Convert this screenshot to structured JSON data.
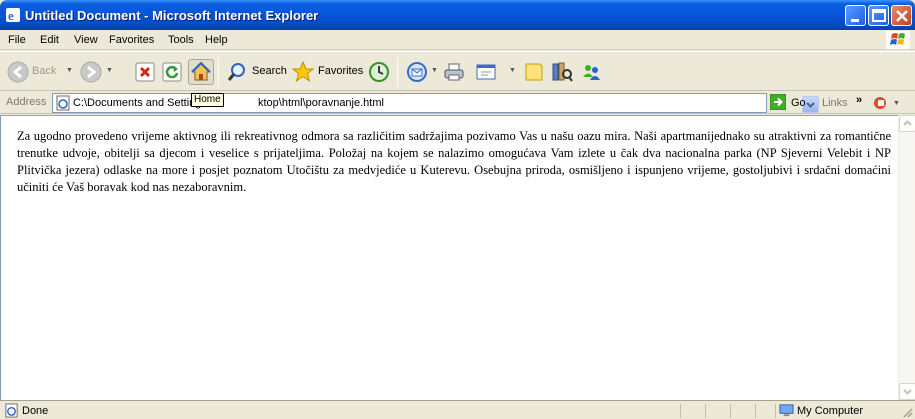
{
  "window": {
    "title": "Untitled Document - Microsoft Internet Explorer"
  },
  "menu": {
    "items": [
      "File",
      "Edit",
      "View",
      "Favorites",
      "Tools",
      "Help"
    ]
  },
  "toolbar": {
    "back_label": "Back",
    "search_label": "Search",
    "favorites_label": "Favorites",
    "icons": [
      "back-icon",
      "forward-icon",
      "stop-icon",
      "refresh-icon",
      "home-icon",
      "search-icon",
      "favorites-icon",
      "history-icon",
      "mail-icon",
      "print-icon",
      "edit-icon",
      "folder-icon",
      "research-icon",
      "messenger-icon"
    ]
  },
  "address": {
    "label": "Address",
    "value": "C:\\Documents and Settings\\...\\Desktop\\html\\poravnanje.html",
    "value_visible_left": "C:\\Documents and Setting",
    "value_visible_right": "ktop\\html\\poravnanje.html",
    "go_label": "Go",
    "links_label": "Links"
  },
  "tooltip": {
    "text": "Home"
  },
  "content": {
    "paragraph": "Za ugodno provedeno vrijeme aktivnog ili rekreativnog odmora sa različitim sadržajima pozivamo Vas u našu oazu mira. Naši apartmanijednako su atraktivni za romantične trenutke udvoje, obitelji sa djecom i veselice s prijateljima. Položaj na kojem se nalazimo omogućava Vam izlete u čak dva nacionalna parka (NP Sjeverni Velebit i NP Plitvička jezera) odlaske na more i posjet poznatom Utočištu za medvjediće u Kuterevu. Osebujna priroda, osmišljeno i ispunjeno vrijeme, gostoljubivi i srdačni domaćini učiniti će Vaš boravak kod nas nezaboravnim."
  },
  "status": {
    "text": "Done",
    "zone": "My Computer"
  },
  "colors": {
    "titlebar": "#0754d8",
    "chrome": "#ece9d8",
    "tooltip_bg": "#ffffe1"
  }
}
